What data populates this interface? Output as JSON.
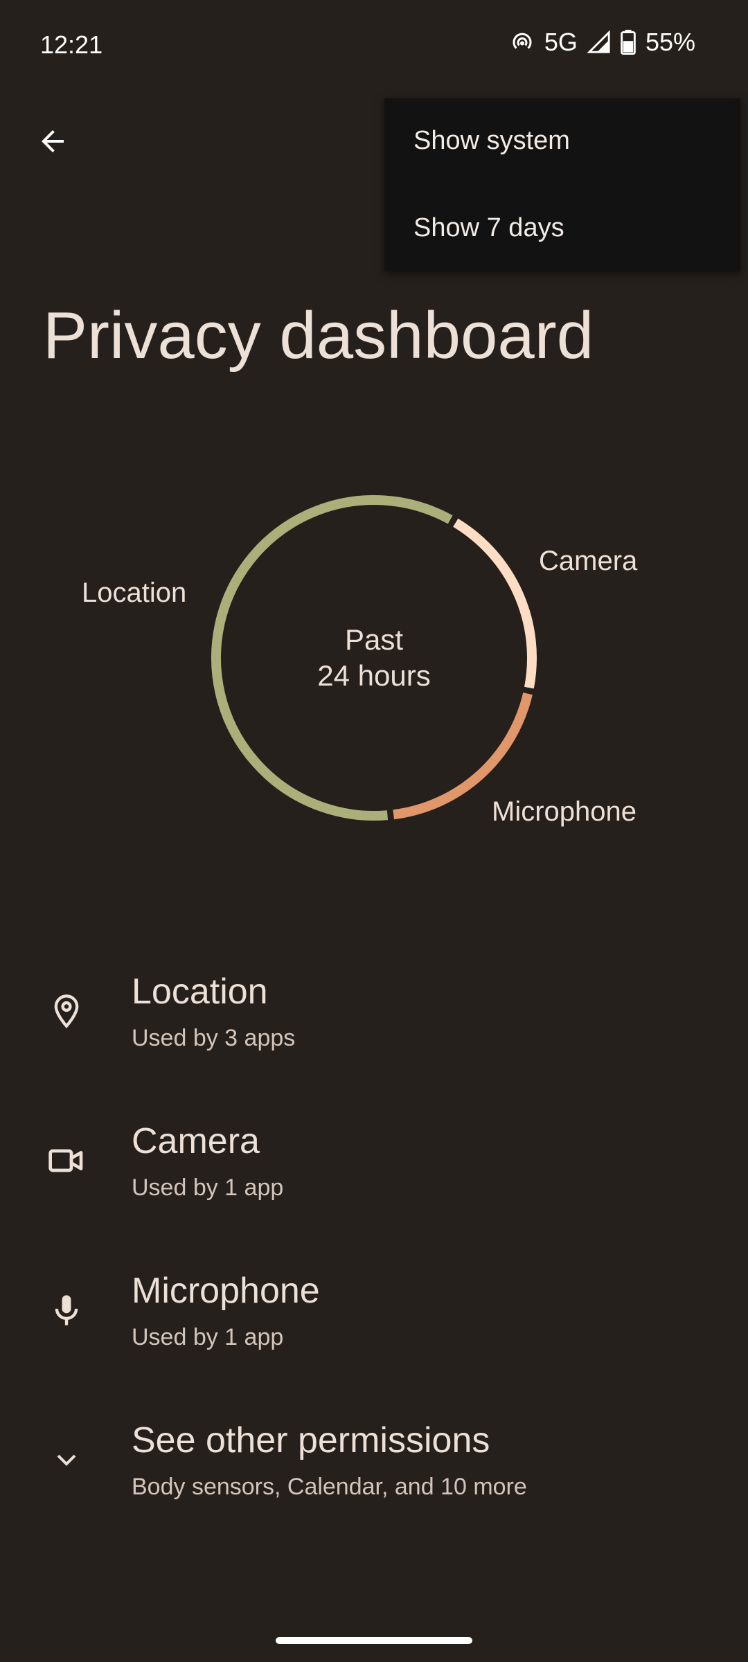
{
  "status_bar": {
    "time": "12:21",
    "network": "5G",
    "battery": "55%",
    "icons": [
      "hotspot-icon",
      "signal-icon",
      "battery-icon"
    ]
  },
  "toolbar": {
    "back_icon": "arrow-back-icon"
  },
  "overflow_menu": {
    "items": [
      {
        "label": "Show system"
      },
      {
        "label": "Show 7 days"
      }
    ]
  },
  "page": {
    "title": "Privacy dashboard"
  },
  "chart_data": {
    "type": "pie",
    "center_label_line1": "Past",
    "center_label_line2": "24 hours",
    "labels": [
      "Location",
      "Camera",
      "Microphone"
    ],
    "values": [
      60,
      20,
      20
    ],
    "colors": [
      "#abb07b",
      "#ffdcc4",
      "#e0976a"
    ]
  },
  "permissions": [
    {
      "icon": "location-pin-icon",
      "title": "Location",
      "subtitle": "Used by 3 apps"
    },
    {
      "icon": "camera-icon",
      "title": "Camera",
      "subtitle": "Used by 1 app"
    },
    {
      "icon": "microphone-icon",
      "title": "Microphone",
      "subtitle": "Used by 1 app"
    },
    {
      "icon": "chevron-down-icon",
      "title": "See other permissions",
      "subtitle": "Body sensors, Calendar, and 10 more"
    }
  ]
}
